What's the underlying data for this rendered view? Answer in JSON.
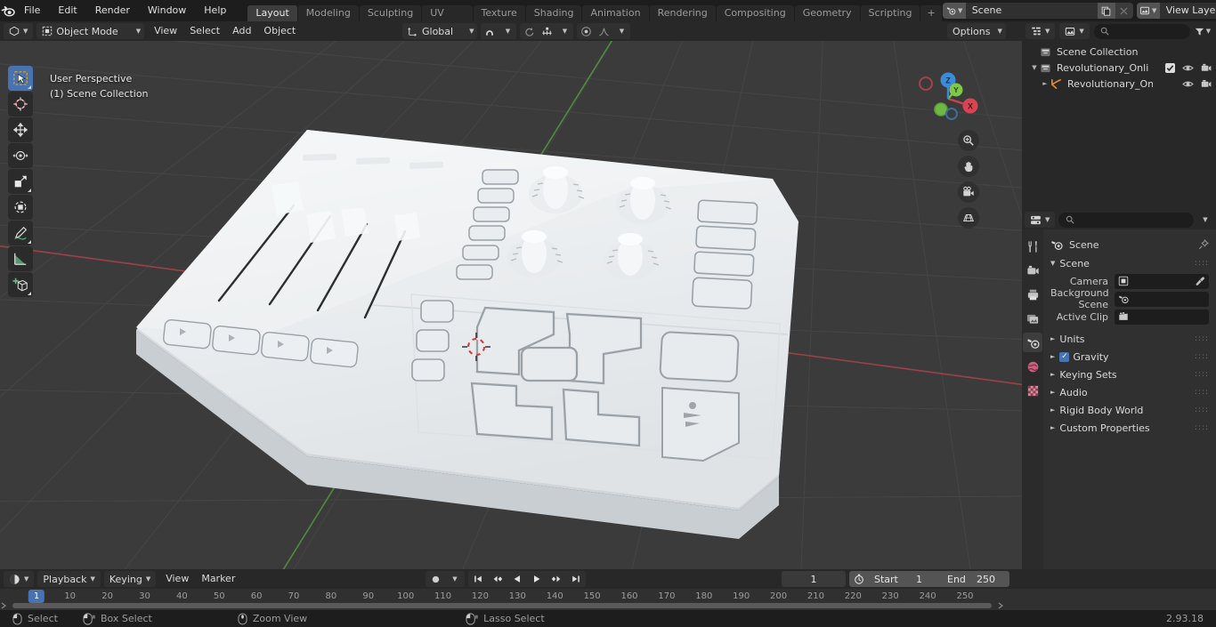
{
  "app": {
    "name": "Blender",
    "version": "2.93.18"
  },
  "topbar": {
    "logo_icon": "blender-logo-icon",
    "menus": [
      "File",
      "Edit",
      "Render",
      "Window",
      "Help"
    ],
    "workspace_tabs": [
      {
        "label": "Layout",
        "active": true
      },
      {
        "label": "Modeling",
        "active": false
      },
      {
        "label": "Sculpting",
        "active": false
      },
      {
        "label": "UV Editing",
        "active": false
      },
      {
        "label": "Texture Paint",
        "active": false
      },
      {
        "label": "Shading",
        "active": false
      },
      {
        "label": "Animation",
        "active": false
      },
      {
        "label": "Rendering",
        "active": false
      },
      {
        "label": "Compositing",
        "active": false
      },
      {
        "label": "Geometry Nodes",
        "active": false
      },
      {
        "label": "Scripting",
        "active": false
      }
    ],
    "add_workspace_label": "+",
    "scene_selector": {
      "icon": "scene-icon",
      "value": "Scene",
      "duplicate_icon": "duplicate-icon",
      "remove_icon": "x-icon"
    },
    "view_layer_selector": {
      "icon": "view-layer-icon",
      "value": "View Layer",
      "duplicate_icon": "duplicate-icon",
      "remove_icon": "x-icon"
    }
  },
  "viewport_header": {
    "editor_type_icon": "editor-3dview-icon",
    "mode": "Object Mode",
    "menus": [
      "View",
      "Select",
      "Add",
      "Object"
    ],
    "transform_orientation": {
      "icon": "orientation-icon",
      "value": "Global"
    },
    "snap_magnet_icon": "magnet-icon",
    "proportional_icon": "proportional-edit-icon",
    "proportional_falloff_icon": "falloff-curve-icon",
    "snap_target_icon": "snap-increment-icon",
    "options_label": "Options",
    "gizmo_icon": "gizmo-icon",
    "overlays_icon": "overlays-icon",
    "xray_icon": "xray-icon",
    "shading_modes": [
      {
        "name": "wireframe-shading-icon",
        "active": false
      },
      {
        "name": "solid-shading-icon",
        "active": false
      },
      {
        "name": "material-preview-shading-icon",
        "active": true
      },
      {
        "name": "rendered-shading-icon",
        "active": false
      }
    ],
    "show_overlays_icon": "show-overlays-icon"
  },
  "viewport": {
    "overlay_line1": "User Perspective",
    "overlay_line2": "(1) Scene Collection",
    "background_color": "#3b3b3b",
    "grid_color": "#4a4a4a",
    "axis_x_color": "#a7484f",
    "axis_y_color": "#5fa74f",
    "model_description": "White broadcast audio mixer control panel with faders, knobs and buttons",
    "model_color": "#eef0f2",
    "toolbar": [
      {
        "name": "tweak-select-box-icon",
        "active": true
      },
      {
        "name": "cursor-icon",
        "active": false
      },
      {
        "name": "move-icon",
        "active": false
      },
      {
        "name": "rotate-icon",
        "active": false
      },
      {
        "name": "scale-icon",
        "active": false
      },
      {
        "name": "transform-icon",
        "active": false
      },
      {
        "name": "annotate-icon",
        "active": false
      },
      {
        "name": "measure-icon",
        "active": false
      },
      {
        "name": "add-cube-icon",
        "active": false
      }
    ],
    "nav_gizmo": {
      "axis_x_label": "X",
      "axis_y_label": "Y",
      "axis_z_label": "Z",
      "x_color": "#e04a5a",
      "y_color": "#8bd44a",
      "z_color": "#3b8fe0"
    },
    "nav_buttons": [
      {
        "name": "zoom-view-icon"
      },
      {
        "name": "pan-view-icon"
      },
      {
        "name": "camera-view-icon"
      },
      {
        "name": "toggle-perspective-icon"
      }
    ],
    "cursor_3d": "3d-cursor-icon"
  },
  "outliner": {
    "display_mode_icon": "outliner-display-mode-icon",
    "search_icon": "search-icon",
    "filter_icon": "filter-icon",
    "settings_icon": "outliner-settings-icon",
    "rows": [
      {
        "label": "Scene Collection",
        "icon": "collection-icon",
        "indent": 0,
        "has_disclosure": false,
        "expanded": false,
        "checkbox": false,
        "eye": false,
        "camera": false
      },
      {
        "label": "Revolutionary_Online_Broadc",
        "icon": "collection-icon",
        "indent": 1,
        "has_disclosure": true,
        "expanded": true,
        "checkbox": true,
        "eye": true,
        "camera": true
      },
      {
        "label": "Revolutionary_Online_Br",
        "icon": "mesh-object-icon",
        "indent": 2,
        "has_disclosure": true,
        "expanded": false,
        "checkbox": false,
        "eye": true,
        "camera": true
      }
    ]
  },
  "properties": {
    "editor_icon": "properties-editor-icon",
    "search_placeholder": "",
    "search_icon": "search-icon",
    "dropdown_icon": "chevron-down-icon",
    "tabs": [
      {
        "name": "tool-tab-icon",
        "active": false
      },
      {
        "name": "render-tab-icon",
        "active": false
      },
      {
        "name": "output-tab-icon",
        "active": false
      },
      {
        "name": "view-layer-tab-icon",
        "active": false
      },
      {
        "name": "scene-tab-icon",
        "active": true
      },
      {
        "name": "world-tab-icon",
        "active": false
      },
      {
        "name": "texture-tab-icon",
        "active": false
      }
    ],
    "breadcrumb": {
      "icon": "scene-icon",
      "label": "Scene",
      "pin_icon": "pin-icon"
    },
    "panels": [
      {
        "title": "Scene",
        "expanded": true,
        "fields": [
          {
            "label": "Camera",
            "icon": "camera-data-icon",
            "value": "",
            "eyedropper": true
          },
          {
            "label": "Background Scene",
            "icon": "scene-icon",
            "value": "",
            "eyedropper": false
          },
          {
            "label": "Active Clip",
            "icon": "clip-icon",
            "value": "",
            "eyedropper": false
          }
        ]
      },
      {
        "title": "Units",
        "expanded": false,
        "fields": []
      },
      {
        "title": "Gravity",
        "expanded": false,
        "checkbox": true,
        "fields": []
      },
      {
        "title": "Keying Sets",
        "expanded": false,
        "fields": []
      },
      {
        "title": "Audio",
        "expanded": false,
        "fields": []
      },
      {
        "title": "Rigid Body World",
        "expanded": false,
        "fields": []
      },
      {
        "title": "Custom Properties",
        "expanded": false,
        "fields": []
      }
    ]
  },
  "timeline": {
    "editor_icon": "timeline-editor-icon",
    "playback_label": "Playback",
    "keying_label": "Keying",
    "view_label": "View",
    "marker_label": "Marker",
    "record_icon": "record-icon",
    "transport": [
      {
        "name": "jump-start-icon"
      },
      {
        "name": "prev-keyframe-icon"
      },
      {
        "name": "play-reverse-icon"
      },
      {
        "name": "play-icon"
      },
      {
        "name": "next-keyframe-icon"
      },
      {
        "name": "jump-end-icon"
      }
    ],
    "current_frame": "1",
    "use_preview_range_icon": "stopwatch-icon",
    "start_label": "Start",
    "start_value": "1",
    "end_label": "End",
    "end_value": "250",
    "playhead_frame": "1",
    "ruler_ticks": [
      10,
      20,
      30,
      40,
      50,
      60,
      70,
      80,
      90,
      100,
      110,
      120,
      130,
      140,
      150,
      160,
      170,
      180,
      190,
      200,
      210,
      220,
      230,
      240,
      250
    ]
  },
  "statusbar": {
    "items": [
      {
        "icon": "mouse-left-icon",
        "label": "Select"
      },
      {
        "icon": "mouse-left-drag-icon",
        "label": "Box Select"
      },
      {
        "icon": "mouse-middle-icon",
        "label": "Zoom View"
      },
      {
        "icon": "mouse-left-ctrl-icon",
        "label": "Lasso Select"
      }
    ],
    "version": "2.93.18"
  }
}
